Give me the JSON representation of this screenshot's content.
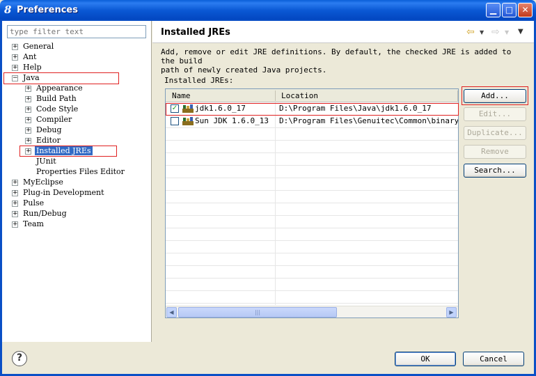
{
  "window": {
    "title": "Preferences",
    "app_icon": "8"
  },
  "filter": {
    "placeholder": "type filter text"
  },
  "tree": {
    "items": [
      {
        "label": "General",
        "expander": "+"
      },
      {
        "label": "Ant",
        "expander": "+"
      },
      {
        "label": "Help",
        "expander": "+"
      },
      {
        "label": "Java",
        "expander": "−"
      },
      {
        "label": "Appearance",
        "expander": "+"
      },
      {
        "label": "Build Path",
        "expander": "+"
      },
      {
        "label": "Code Style",
        "expander": "+"
      },
      {
        "label": "Compiler",
        "expander": "+"
      },
      {
        "label": "Debug",
        "expander": "+"
      },
      {
        "label": "Editor",
        "expander": "+"
      },
      {
        "label": "Installed JREs",
        "expander": "+"
      },
      {
        "label": "JUnit",
        "expander": ""
      },
      {
        "label": "Properties Files Editor",
        "expander": ""
      },
      {
        "label": "MyEclipse",
        "expander": "+"
      },
      {
        "label": "Plug-in Development",
        "expander": "+"
      },
      {
        "label": "Pulse",
        "expander": "+"
      },
      {
        "label": "Run/Debug",
        "expander": "+"
      },
      {
        "label": "Team",
        "expander": "+"
      }
    ]
  },
  "page": {
    "title": "Installed JREs",
    "nav_back": "⇦",
    "nav_forward": "⇨",
    "nav_menu": "▼",
    "desc_line1": "Add, remove or edit JRE definitions. By default, the checked JRE is added to the build",
    "desc_line2": "path of newly created Java projects.",
    "table_label": "Installed JREs:"
  },
  "table": {
    "col_name": "Name",
    "col_location": "Location",
    "rows": [
      {
        "checked": true,
        "check_mark": "✓",
        "name": "jdk1.6.0_17",
        "location": "D:\\Program Files\\Java\\jdk1.6.0_17"
      },
      {
        "checked": false,
        "check_mark": "",
        "name": "Sun JDK 1.6.0_13",
        "location": "D:\\Program Files\\Genuitec\\Common\\binary\\com"
      }
    ],
    "scroll_left": "◀",
    "scroll_right": "▶",
    "scroll_grip": "|||"
  },
  "side_buttons": {
    "add": "Add...",
    "edit": "Edit...",
    "duplicate": "Duplicate...",
    "remove": "Remove",
    "search": "Search..."
  },
  "dialog": {
    "help": "?",
    "ok": "OK",
    "cancel": "Cancel"
  },
  "colors": {
    "selection": "#316ac5",
    "highlight_box": "#e02020",
    "titlebar": "#0a58d4"
  }
}
